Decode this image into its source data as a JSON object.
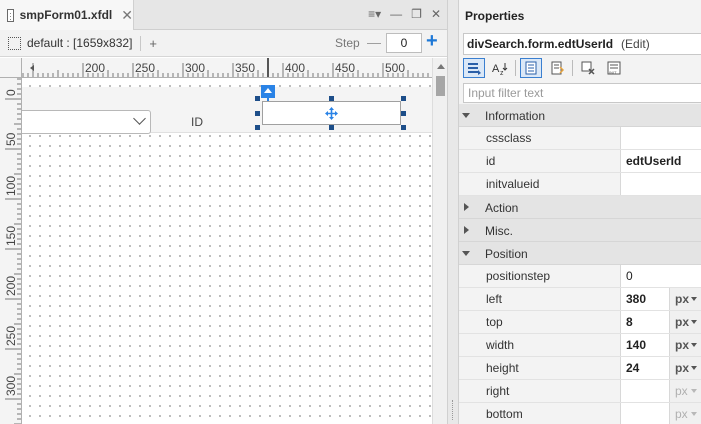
{
  "editor": {
    "tab_title": "smpForm01.xfdl",
    "layout_label": "default : [1659x832]",
    "add_layout": "+",
    "step_label": "Step",
    "step_value": "0",
    "window_controls": [
      "≡▾",
      "—",
      "❐",
      "✕"
    ]
  },
  "rulers": {
    "horizontal_ticks": [
      "200",
      "250",
      "300",
      "350",
      "400",
      "450",
      "500"
    ],
    "vertical_ticks": [
      "0",
      "50",
      "100",
      "150",
      "200",
      "250",
      "300"
    ]
  },
  "canvas": {
    "id_label": "ID",
    "combo_value": ""
  },
  "properties": {
    "title": "Properties",
    "object_name": "divSearch.form.edtUserId",
    "object_mode": "(Edit)",
    "filter_placeholder": "Input filter text",
    "categories": [
      {
        "label": "Information",
        "expanded": true,
        "rows": [
          {
            "name": "cssclass",
            "value": "",
            "bold": false
          },
          {
            "name": "id",
            "value": "edtUserId",
            "bold": true
          },
          {
            "name": "initvalueid",
            "value": "",
            "bold": false
          }
        ]
      },
      {
        "label": "Action",
        "expanded": false,
        "rows": []
      },
      {
        "label": "Misc.",
        "expanded": false,
        "rows": []
      },
      {
        "label": "Position",
        "expanded": true,
        "rows": [
          {
            "name": "positionstep",
            "value": "0",
            "bold": false,
            "unit": ""
          },
          {
            "name": "left",
            "value": "380",
            "bold": true,
            "unit": "px"
          },
          {
            "name": "top",
            "value": "8",
            "bold": true,
            "unit": "px"
          },
          {
            "name": "width",
            "value": "140",
            "bold": true,
            "unit": "px"
          },
          {
            "name": "height",
            "value": "24",
            "bold": true,
            "unit": "px"
          },
          {
            "name": "right",
            "value": "",
            "bold": false,
            "unit": "px",
            "unit_disabled": true
          },
          {
            "name": "bottom",
            "value": "",
            "bold": false,
            "unit": "px",
            "unit_disabled": true
          }
        ]
      }
    ]
  },
  "colors": {
    "accent": "#2a83e6",
    "selection_handle": "#1d4e89"
  }
}
